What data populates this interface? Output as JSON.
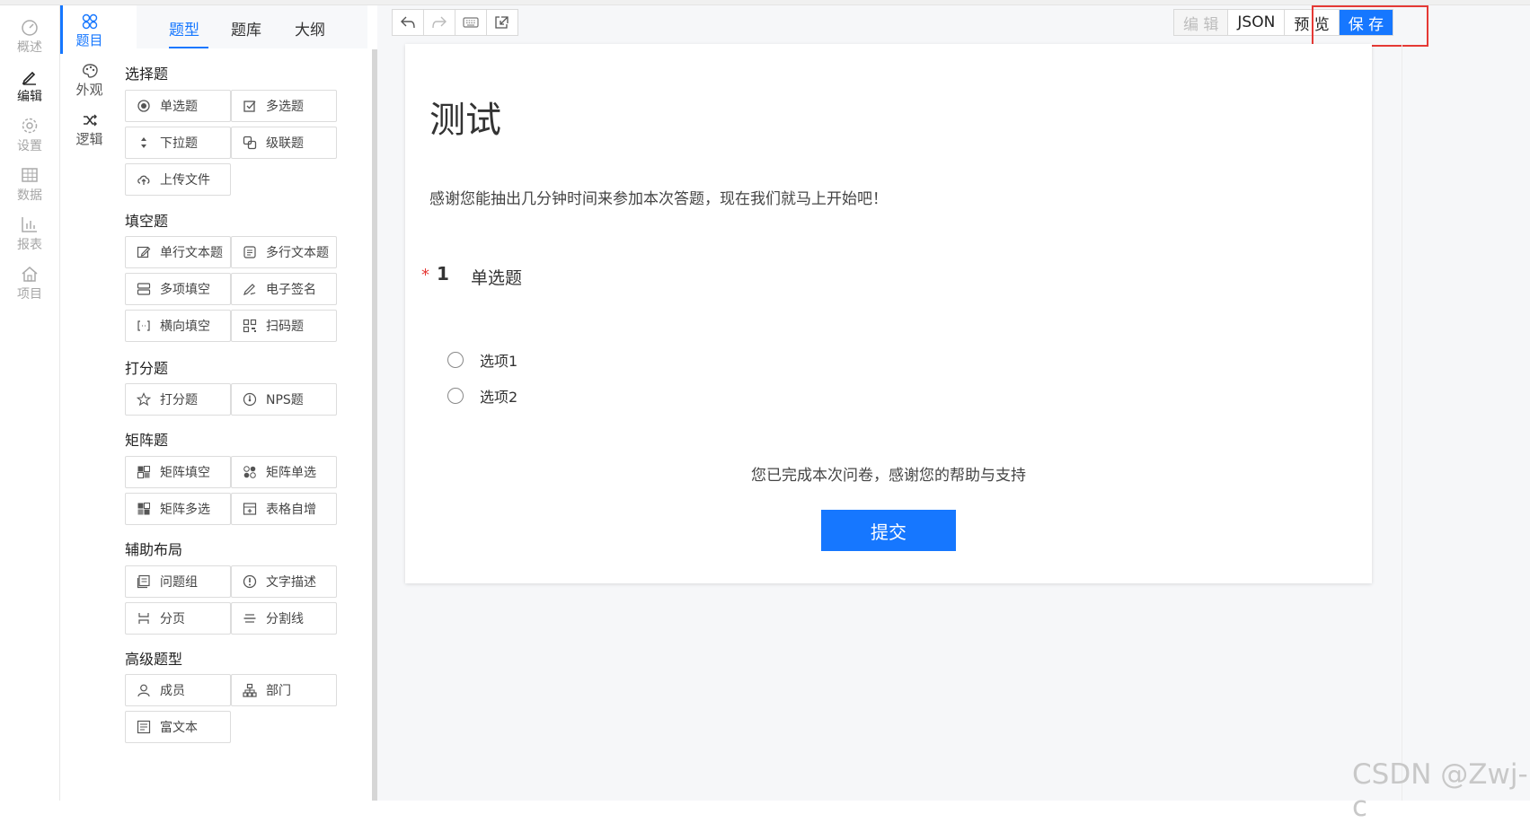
{
  "nav_main": [
    {
      "label": "概述",
      "icon": "dashboard-icon"
    },
    {
      "label": "编辑",
      "icon": "pencil-icon",
      "active": true
    },
    {
      "label": "设置",
      "icon": "gear-icon"
    },
    {
      "label": "数据",
      "icon": "table-icon"
    },
    {
      "label": "报表",
      "icon": "bar-chart-icon"
    },
    {
      "label": "项目",
      "icon": "home-icon"
    }
  ],
  "nav_sub": [
    {
      "label": "题目",
      "icon": "question-grid-icon",
      "active": true
    },
    {
      "label": "外观",
      "icon": "palette-icon"
    },
    {
      "label": "逻辑",
      "icon": "shuffle-icon"
    }
  ],
  "palette": {
    "tabs": [
      "题型",
      "题库",
      "大纲"
    ],
    "active_tab": "题型",
    "sections": [
      {
        "title": "选择题",
        "items": [
          {
            "label": "单选题",
            "icon": "radio-icon"
          },
          {
            "label": "多选题",
            "icon": "checkbox-icon"
          },
          {
            "label": "下拉题",
            "icon": "dropdown-icon"
          },
          {
            "label": "级联题",
            "icon": "cascade-icon"
          },
          {
            "label": "上传文件",
            "icon": "upload-icon"
          }
        ]
      },
      {
        "title": "填空题",
        "items": [
          {
            "label": "单行文本题",
            "icon": "edit-icon"
          },
          {
            "label": "多行文本题",
            "icon": "textarea-icon"
          },
          {
            "label": "多项填空",
            "icon": "multi-input-icon"
          },
          {
            "label": "电子签名",
            "icon": "signature-icon"
          },
          {
            "label": "横向填空",
            "icon": "bracket-icon"
          },
          {
            "label": "扫码题",
            "icon": "qrcode-icon"
          }
        ]
      },
      {
        "title": "打分题",
        "items": [
          {
            "label": "打分题",
            "icon": "star-icon"
          },
          {
            "label": "NPS题",
            "icon": "gauge-icon"
          }
        ]
      },
      {
        "title": "矩阵题",
        "items": [
          {
            "label": "矩阵填空",
            "icon": "matrix-icon"
          },
          {
            "label": "矩阵单选",
            "icon": "matrix-radio-icon"
          },
          {
            "label": "矩阵多选",
            "icon": "matrix-check-icon"
          },
          {
            "label": "表格自增",
            "icon": "table-add-icon"
          }
        ]
      },
      {
        "title": "辅助布局",
        "items": [
          {
            "label": "问题组",
            "icon": "group-icon"
          },
          {
            "label": "文字描述",
            "icon": "info-icon"
          },
          {
            "label": "分页",
            "icon": "pagebreak-icon"
          },
          {
            "label": "分割线",
            "icon": "divider-icon"
          }
        ]
      },
      {
        "title": "高级题型",
        "items": [
          {
            "label": "成员",
            "icon": "user-icon"
          },
          {
            "label": "部门",
            "icon": "org-icon"
          },
          {
            "label": "富文本",
            "icon": "richtext-icon"
          }
        ]
      }
    ]
  },
  "toolbar": {
    "left_tools": [
      "undo-icon",
      "redo-icon",
      "keyboard-icon",
      "import-icon"
    ],
    "edit_label": "编 辑",
    "json_label": "JSON",
    "preview_label": "预 览",
    "save_label": "保 存"
  },
  "survey": {
    "title": "测试",
    "description": "感谢您能抽出几分钟时间来参加本次答题，现在我们就马上开始吧！",
    "question": {
      "required_mark": "*",
      "number": "1",
      "title": "单选题",
      "options": [
        "选项1",
        "选项2"
      ]
    },
    "finish_text": "您已完成本次问卷，感谢您的帮助与支持",
    "submit_label": "提交"
  },
  "watermark": "CSDN @Zwj-c",
  "colors": {
    "accent": "#1677ff",
    "highlight": "#e53935"
  }
}
